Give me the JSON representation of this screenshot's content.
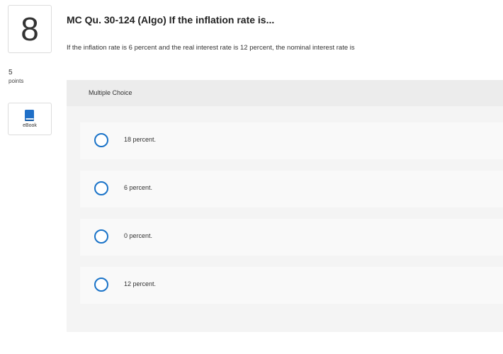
{
  "question": {
    "number": "8",
    "points_value": "5",
    "points_label": "points",
    "title": "MC Qu. 30-124 (Algo) If the inflation rate is...",
    "text": "If the inflation rate is 6 percent and the real interest rate is 12 percent, the nominal interest rate is"
  },
  "sidebar": {
    "ebook_label": "eBook",
    "ebook_icon": "book-icon",
    "ebook_color": "#1f6fc7"
  },
  "answer_panel": {
    "header": "Multiple Choice",
    "options": [
      {
        "label": "18 percent."
      },
      {
        "label": "6 percent."
      },
      {
        "label": "0 percent."
      },
      {
        "label": "12 percent."
      }
    ]
  },
  "colors": {
    "radio_border": "#1a73c8",
    "panel_bg": "#f4f4f4",
    "header_bg": "#ececec"
  }
}
